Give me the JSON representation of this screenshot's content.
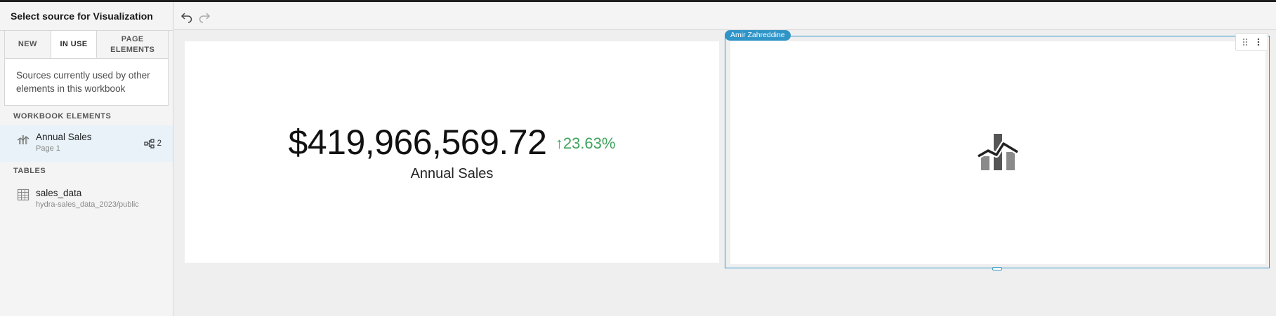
{
  "sidebar": {
    "title": "Select source for Visualization",
    "tabs": [
      {
        "label": "NEW",
        "active": false
      },
      {
        "label": "IN USE",
        "active": true
      },
      {
        "label": "PAGE ELEMENTS",
        "active": false
      }
    ],
    "description": "Sources currently used by other elements in this workbook",
    "sections": {
      "workbook_elements": {
        "heading": "WORKBOOK ELEMENTS",
        "items": [
          {
            "name": "Annual Sales",
            "sub": "Page 1",
            "icon": "chart-icon",
            "usage_count": "2",
            "selected": true
          }
        ]
      },
      "tables": {
        "heading": "TABLES",
        "items": [
          {
            "name": "sales_data",
            "sub": "hydra-sales_data_2023/public",
            "icon": "table-icon"
          }
        ]
      }
    }
  },
  "toolbar": {
    "undo": "undo-icon",
    "redo": "redo-icon"
  },
  "kpi": {
    "value": "$419,966,569.72",
    "delta_arrow": "↑",
    "delta": "23.63%",
    "delta_color": "#3fa35b",
    "title": "Annual Sales"
  },
  "viz": {
    "user_tag": "Amir Zahreddine",
    "accent": "#2f95c8",
    "placeholder_icon": "bar-line-chart-icon"
  }
}
